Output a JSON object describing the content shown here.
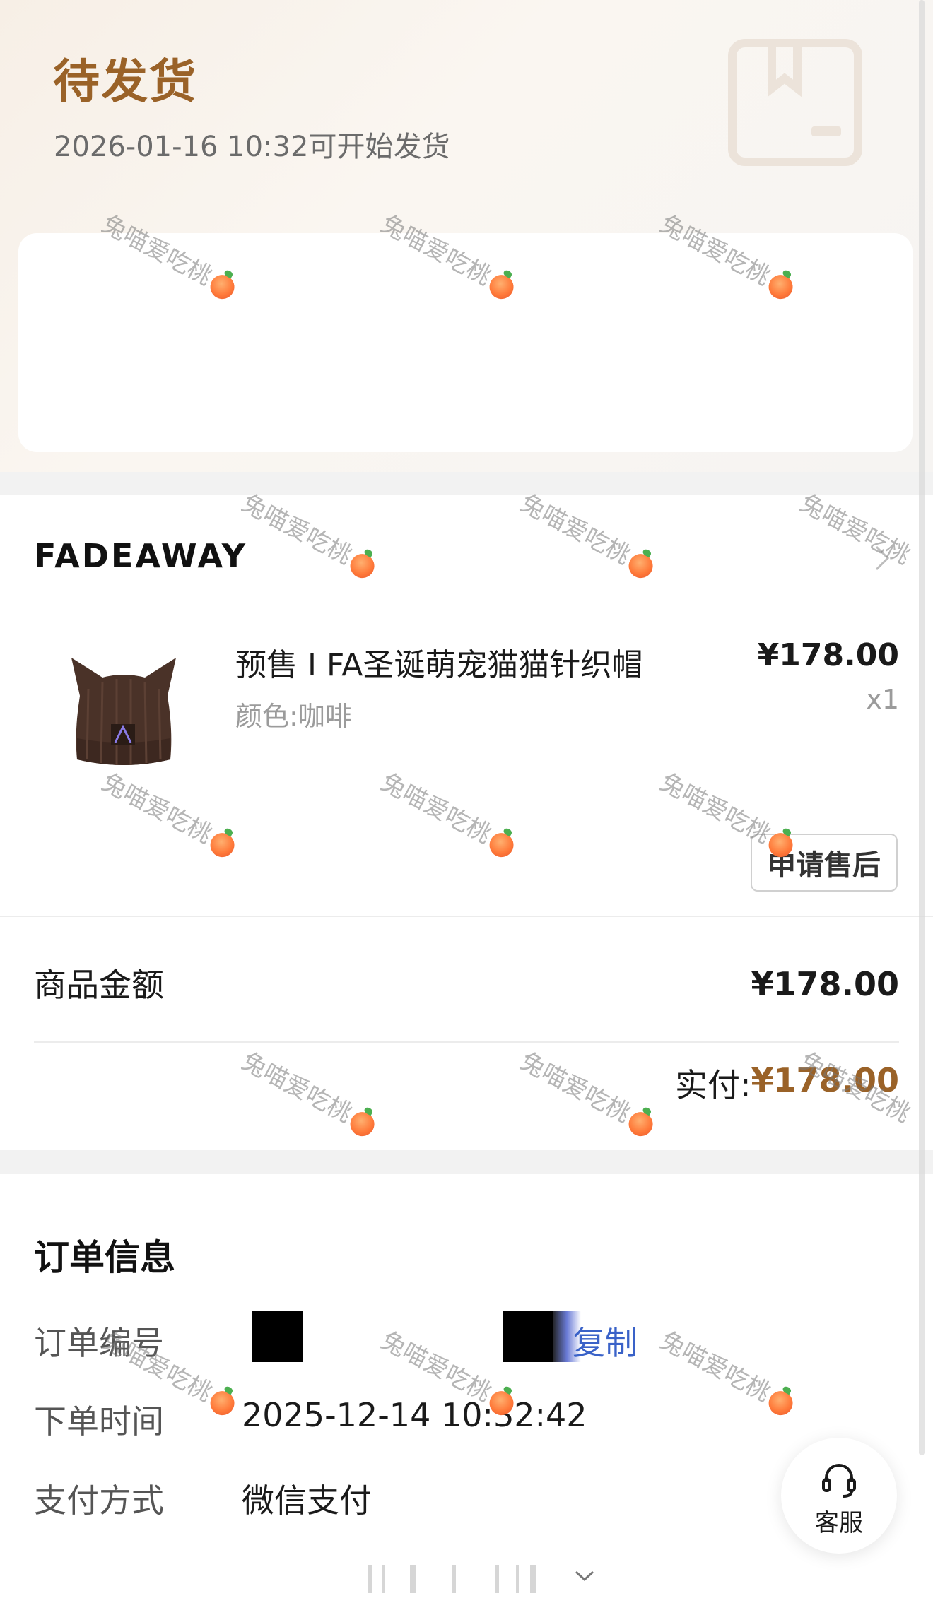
{
  "header": {
    "status_title": "待发货",
    "status_subtitle": "2026-01-16 10:32可开始发货",
    "status_icon": "package-icon"
  },
  "store": {
    "name": "FADEAWAY"
  },
  "product": {
    "title": "预售 I FA圣诞萌宠猫猫针织帽",
    "spec": "颜色:咖啡",
    "price": "¥178.00",
    "quantity": "x1",
    "after_sale_label": "申请售后"
  },
  "summary": {
    "goods_amount_label": "商品金额",
    "goods_amount_value": "¥178.00",
    "paid_label": "实付:",
    "paid_value": "¥178.00",
    "accent_color": "#9a6228"
  },
  "order_info": {
    "title": "订单信息",
    "order_no_label": "订单编号",
    "copy_label": "复制",
    "order_time_label": "下单时间",
    "order_time_value": "2025-12-14 10:32:42",
    "payment_label": "支付方式",
    "payment_value": "微信支付"
  },
  "customer_service": {
    "label": "客服",
    "icon": "headset-icon"
  },
  "watermark": {
    "text": "兔喵爱吃桃"
  }
}
